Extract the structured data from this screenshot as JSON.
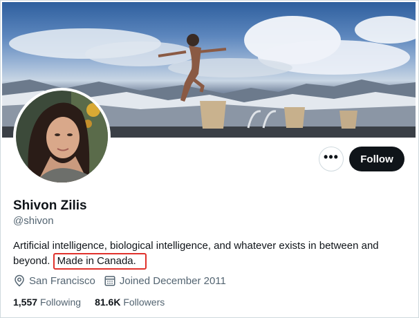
{
  "profile": {
    "name": "Shivon Zilis",
    "handle": "@shivon",
    "bio": "Artificial intelligence, biological intelligence, and whatever exists in between and beyond.",
    "bio_highlight": "Made in Canada.",
    "location": "San Francisco",
    "joined": "Joined December 2011"
  },
  "stats": {
    "following_count": "1,557",
    "following_label": "Following",
    "followers_count": "81.6K",
    "followers_label": "Followers"
  },
  "actions": {
    "more_label": "•••",
    "follow_label": "Follow"
  },
  "icons": {
    "location": "location-pin-icon",
    "joined": "calendar-icon",
    "more": "more-options-icon"
  },
  "colors": {
    "follow_button_bg": "#0f1419",
    "highlight_border": "#e0312b",
    "secondary_text": "#536471"
  }
}
